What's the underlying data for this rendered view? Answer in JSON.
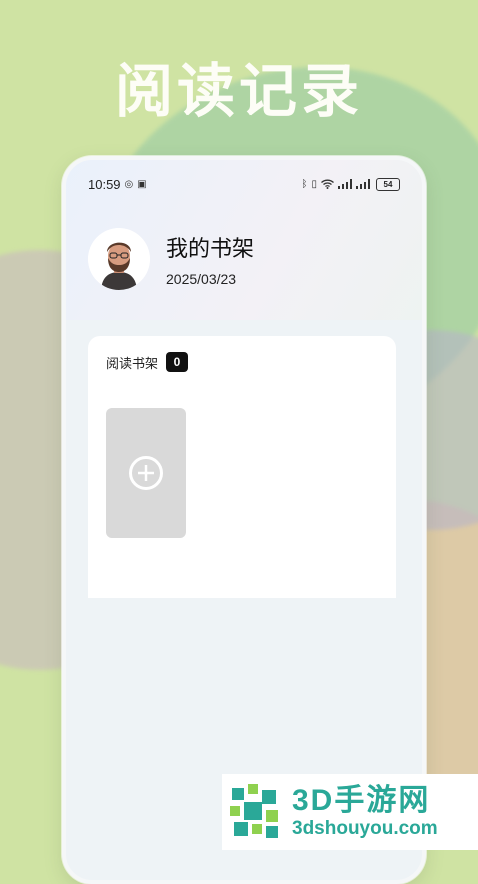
{
  "headline": "阅读记录",
  "status_bar": {
    "time": "10:59",
    "battery": "54"
  },
  "profile": {
    "name": "我的书架",
    "date": "2025/03/23"
  },
  "shelf": {
    "title": "阅读书架",
    "count": "0"
  },
  "watermark": {
    "title": "3D手游网",
    "url": "3dshouyou.com"
  },
  "colors": {
    "background": "#cfe3a3",
    "headline": "#fdfdf6",
    "badge": "#111111",
    "placeholder": "#d9d9d9",
    "watermark": "#2aa898"
  }
}
